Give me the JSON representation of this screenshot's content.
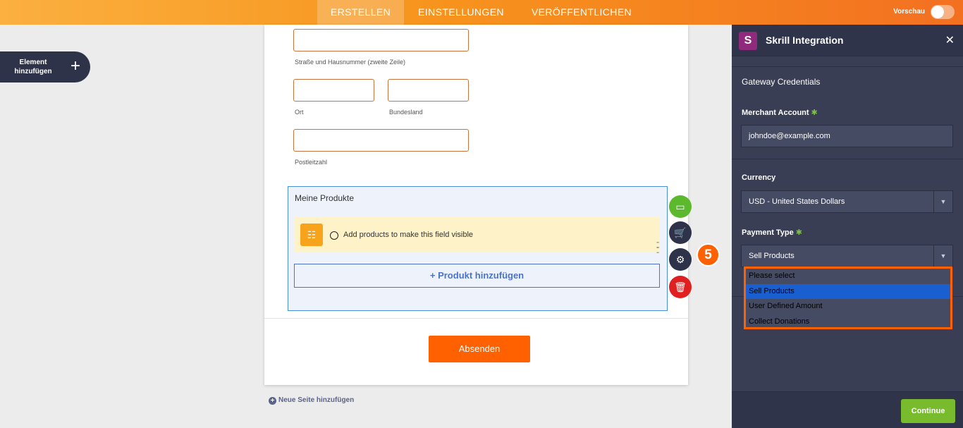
{
  "topbar": {
    "tabs": [
      {
        "label": "ERSTELLEN",
        "active": true
      },
      {
        "label": "EINSTELLUNGEN",
        "active": false
      },
      {
        "label": "VERÖFFENTLICHEN",
        "active": false
      }
    ],
    "preview_label": "Vorschau",
    "preview_enabled": false
  },
  "add_element": {
    "label": "Element hinzufügen",
    "icon": "plus-icon"
  },
  "form": {
    "street2_sublabel": "Straße und Hausnummer (zweite Zeile)",
    "city_sublabel": "Ort",
    "state_sublabel": "Bundesland",
    "zip_sublabel": "Postleitzahl",
    "products_title": "Meine Produkte",
    "products_notice": "Add products to make this field visible",
    "add_product_label": "+ Produkt hinzufügen",
    "submit_label": "Absenden",
    "new_page_label": "Neue Seite hinzufügen"
  },
  "tool_icons": [
    "payment-card-icon",
    "cart-icon",
    "gear-icon",
    "trash-icon"
  ],
  "panel": {
    "logo_letter": "S",
    "title": "Skrill Integration",
    "section_title": "Gateway Credentials",
    "merchant_label": "Merchant Account",
    "merchant_value": "johndoe@example.com",
    "currency_label": "Currency",
    "currency_value": "USD - United States Dollars",
    "payment_type_label": "Payment Type",
    "payment_type_value": "Sell Products",
    "payment_type_options": [
      "Please select",
      "Sell Products",
      "User Defined Amount",
      "Collect Donations"
    ],
    "selected_option": "Sell Products",
    "step_number": "5",
    "continue_label": "Continue"
  },
  "colors": {
    "accent": "#ff6100",
    "panel_bg": "#3a3e55",
    "continue": "#78bb2c",
    "selected_option": "#1a5fd0"
  }
}
